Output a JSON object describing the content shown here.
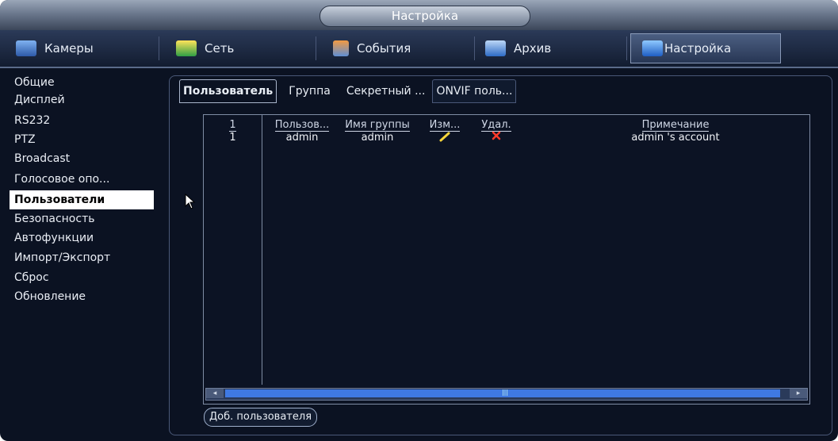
{
  "window": {
    "title": "Настройка"
  },
  "topnav": {
    "tabs": [
      {
        "label": "Камеры",
        "icon": "camera-icon"
      },
      {
        "label": "Сеть",
        "icon": "network-icon"
      },
      {
        "label": "События",
        "icon": "events-icon"
      },
      {
        "label": "Архив",
        "icon": "archive-icon"
      },
      {
        "label": "Настройка",
        "icon": "settings-icon",
        "active": true
      }
    ]
  },
  "sidebar": {
    "items": [
      {
        "label": "Общие"
      },
      {
        "label": "Дисплей"
      },
      {
        "label": "RS232"
      },
      {
        "label": "PTZ"
      },
      {
        "label": "Broadcast"
      },
      {
        "label": "Голосовое опо..."
      },
      {
        "label": "Пользователи",
        "active": true
      },
      {
        "label": "Безопасность"
      },
      {
        "label": "Автофункции"
      },
      {
        "label": "Импорт/Экспорт"
      },
      {
        "label": "Сброс"
      },
      {
        "label": "Обновление"
      }
    ]
  },
  "tabs": [
    {
      "label": "Пользователь",
      "active": true
    },
    {
      "label": "Группа"
    },
    {
      "label": "Секретный ..."
    },
    {
      "label": "ONVIF поль..."
    }
  ],
  "table": {
    "columns": [
      "1",
      "Пользов...",
      "Имя группы",
      "Изм...",
      "Удал.",
      "Примечание"
    ],
    "rows": [
      {
        "num": "1",
        "user": "admin",
        "group": "admin",
        "edit_icon": "pencil-icon",
        "delete_icon": "delete-x-icon",
        "note": "admin 's account"
      }
    ]
  },
  "add_button": {
    "label": "Доб. пользователя"
  },
  "colors": {
    "edit_icon": "#f5d43a",
    "delete_icon": "#ff3a2a",
    "accent": "#3f79e3"
  }
}
